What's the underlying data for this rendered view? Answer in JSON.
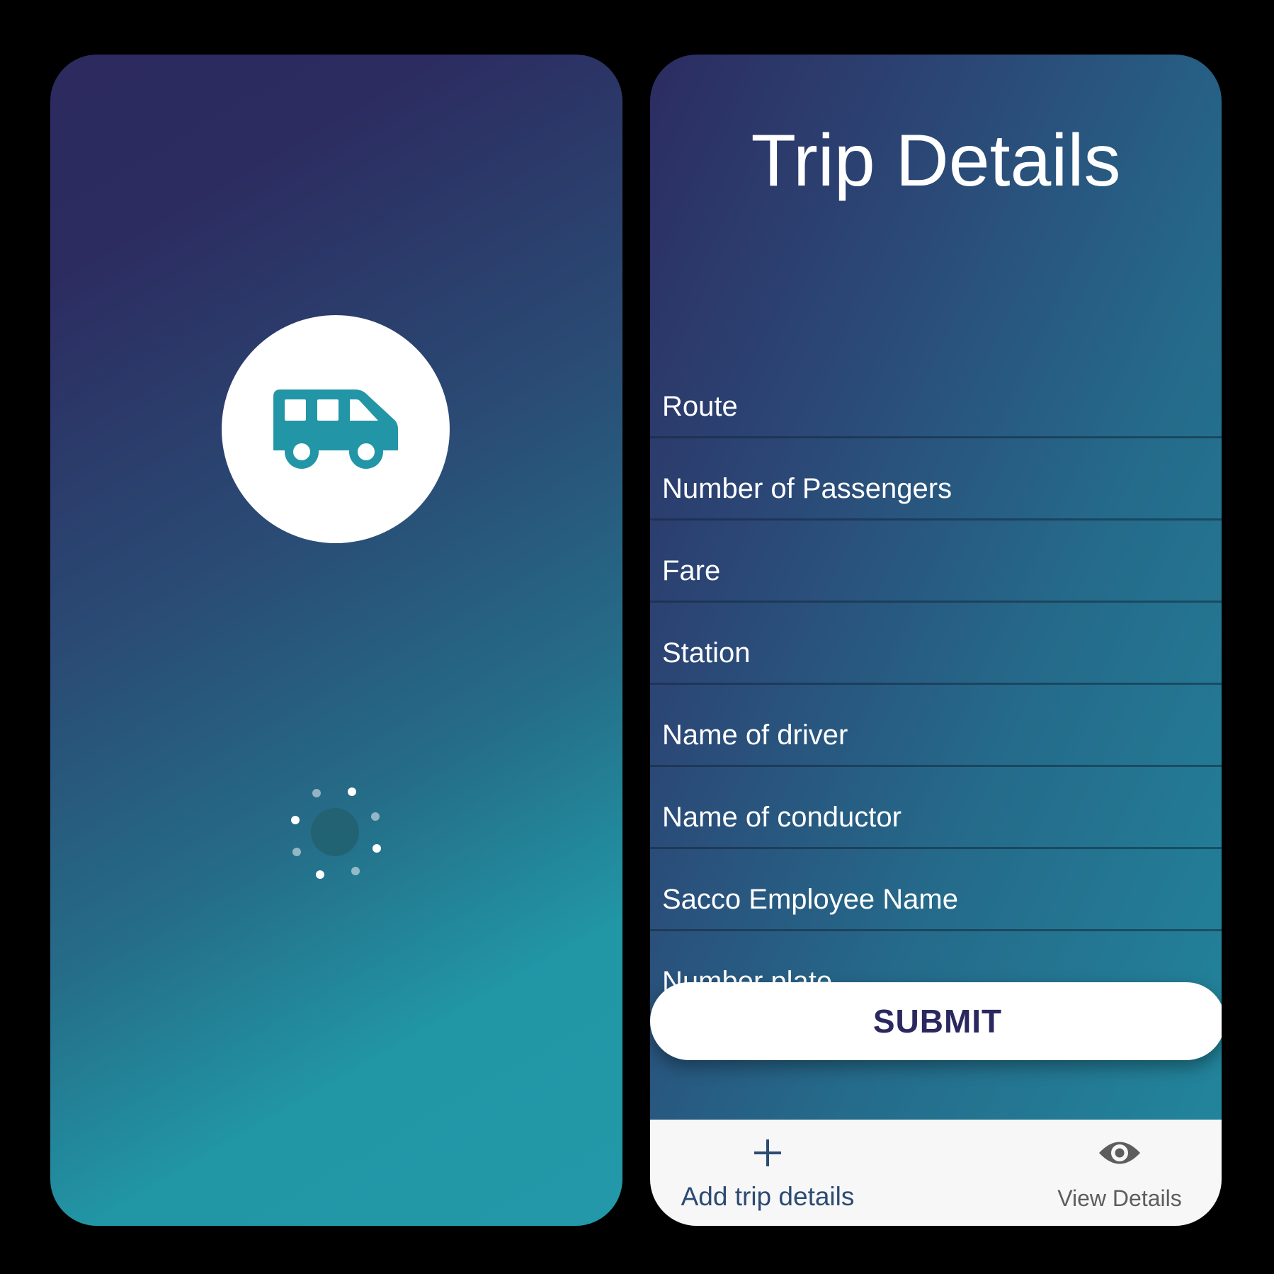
{
  "splash": {
    "logo_icon": "bus-icon",
    "loading_icon": "spinner-icon",
    "colors": {
      "gradient_start": "#2c2c61",
      "gradient_end": "#2298a8",
      "logo_circle": "#ffffff",
      "logo_icon": "#2295a6"
    }
  },
  "form": {
    "title": "Trip Details",
    "fields": [
      {
        "label": "Route"
      },
      {
        "label": "Number of Passengers"
      },
      {
        "label": "Fare"
      },
      {
        "label": "Station"
      },
      {
        "label": "Name of driver"
      },
      {
        "label": "Name of conductor"
      },
      {
        "label": "Sacco Employee Name"
      },
      {
        "label": "Number plate"
      }
    ],
    "submit_label": "SUBMIT",
    "colors": {
      "gradient_start": "#2c2c61",
      "gradient_end": "#21889d",
      "submit_text": "#2a285e"
    }
  },
  "bottom_nav": {
    "items": [
      {
        "label": "Add trip details",
        "icon": "plus-icon",
        "selected": true
      },
      {
        "label": "View Details",
        "icon": "eye-icon",
        "selected": false
      }
    ]
  }
}
